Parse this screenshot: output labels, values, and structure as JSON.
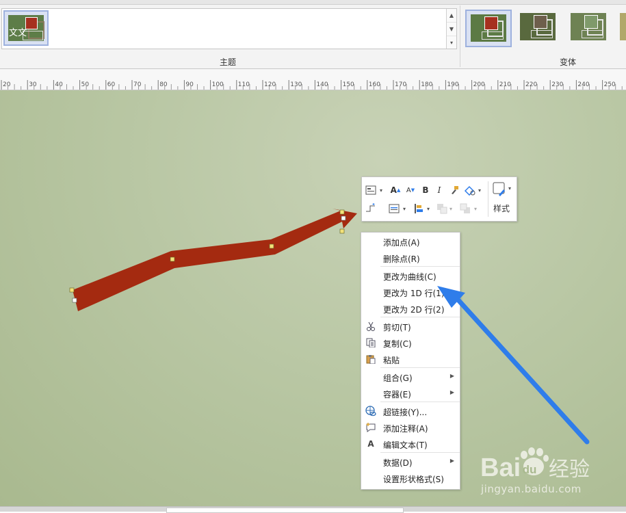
{
  "ribbon": {
    "theme_group_label": "主题",
    "variant_group_label": "变体",
    "theme_thumb_text": "文文",
    "variant_colors": [
      "#5c7a44",
      "#59693e",
      "#6e8253",
      "#b1a86a"
    ],
    "variant_square_colors": [
      "#a6301f",
      "#6e5f4c",
      "#7f9a6b",
      "#c9b97a"
    ]
  },
  "ruler": {
    "ticks": [
      "20",
      "30",
      "40",
      "50",
      "60",
      "70",
      "80",
      "90",
      "100",
      "110",
      "120",
      "130",
      "140",
      "150",
      "160",
      "170",
      "180",
      "190",
      "200",
      "210",
      "220",
      "230",
      "240",
      "250"
    ]
  },
  "canvas": {
    "background_color": "#b9c7a4",
    "arrow_color": "#a42a10"
  },
  "mini_toolbar": {
    "style_label": "样式",
    "bold_label": "B",
    "italic_label": "I",
    "grow_font_label": "A",
    "shrink_font_label": "A"
  },
  "context_menu": {
    "items": [
      {
        "label": "添加点(A)"
      },
      {
        "label": "删除点(R)"
      },
      {
        "label": "更改为曲线(C)"
      },
      {
        "label": "更改为 1D 行(1)"
      },
      {
        "label": "更改为 2D 行(2)"
      },
      {
        "label": "剪切(T)",
        "icon": "scissors-icon"
      },
      {
        "label": "复制(C)",
        "icon": "copy-icon"
      },
      {
        "label": "粘贴",
        "icon": "paste-icon"
      },
      {
        "label": "组合(G)",
        "submenu": true
      },
      {
        "label": "容器(E)",
        "submenu": true
      },
      {
        "label": "超链接(Y)...",
        "icon": "hyperlink-icon"
      },
      {
        "label": "添加注释(A)",
        "icon": "add-comment-icon"
      },
      {
        "label": "编辑文本(T)",
        "icon": "edit-text-icon",
        "icon_glyph": "A"
      },
      {
        "label": "数据(D)",
        "submenu": true
      },
      {
        "label": "设置形状格式(S)"
      }
    ]
  },
  "annotation": {
    "pointer_arrow_color": "#2f7dea"
  },
  "watermark": {
    "brand_text": "Baidu经验",
    "url": "jingyan.baidu.com"
  }
}
